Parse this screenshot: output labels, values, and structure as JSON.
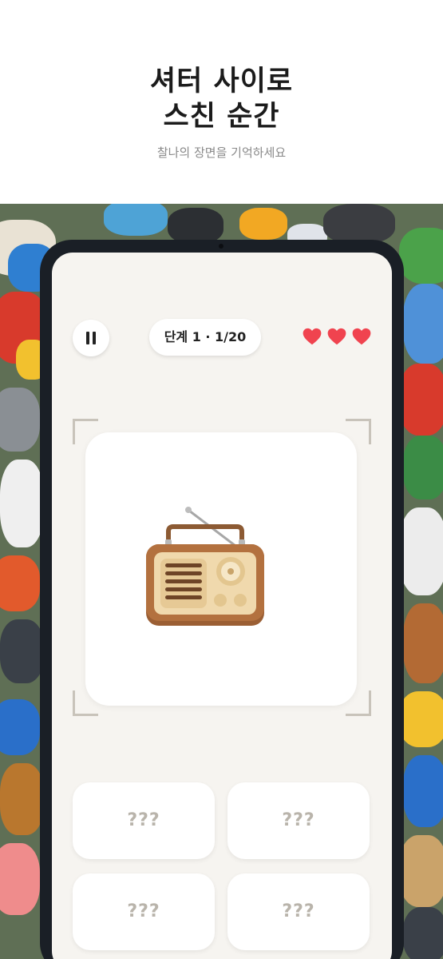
{
  "hero": {
    "title_line1": "셔터 사이로",
    "title_line2": "스친 순간",
    "subtitle": "찰나의 장면을 기억하세요"
  },
  "game": {
    "stage_label": "단계 1 · 1/20",
    "lives": 3,
    "target_object_icon": "vintage-radio-icon",
    "choices": [
      "???",
      "???",
      "???",
      "???"
    ]
  },
  "colors": {
    "heart": "#f0434f",
    "screen_bg": "#f6f4f0",
    "device_frame": "#1a1f26",
    "placeholder_text": "#b9b4ab"
  }
}
